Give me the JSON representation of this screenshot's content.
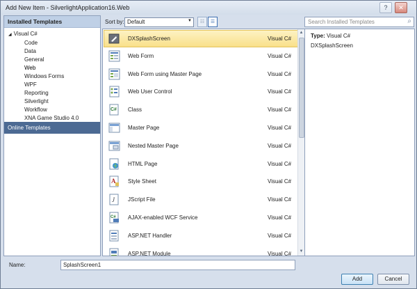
{
  "window": {
    "title": "Add New Item - SilverlightApplication16.Web",
    "help_glyph": "?",
    "close_glyph": "✕"
  },
  "left": {
    "header": "Installed Templates",
    "root": "Visual C#",
    "items": [
      "Code",
      "Data",
      "General",
      "Web",
      "Windows Forms",
      "WPF",
      "Reporting",
      "Silverlight",
      "Workflow",
      "XNA Game Studio 4.0"
    ],
    "selected_index": 3,
    "online": "Online Templates"
  },
  "sort": {
    "label": "Sort by:",
    "value": "Default"
  },
  "search": {
    "placeholder": "Search Installed Templates"
  },
  "templates": [
    {
      "name": "DXSplashScreen",
      "lang": "Visual C#",
      "icon": "splash-icon",
      "selected": true
    },
    {
      "name": "Web Form",
      "lang": "Visual C#",
      "icon": "web-form-icon"
    },
    {
      "name": "Web Form using Master Page",
      "lang": "Visual C#",
      "icon": "web-form-master-icon"
    },
    {
      "name": "Web User Control",
      "lang": "Visual C#",
      "icon": "user-control-icon"
    },
    {
      "name": "Class",
      "lang": "Visual C#",
      "icon": "class-icon"
    },
    {
      "name": "Master Page",
      "lang": "Visual C#",
      "icon": "master-page-icon"
    },
    {
      "name": "Nested Master Page",
      "lang": "Visual C#",
      "icon": "nested-master-icon"
    },
    {
      "name": "HTML Page",
      "lang": "Visual C#",
      "icon": "html-page-icon"
    },
    {
      "name": "Style Sheet",
      "lang": "Visual C#",
      "icon": "style-sheet-icon"
    },
    {
      "name": "JScript File",
      "lang": "Visual C#",
      "icon": "jscript-icon"
    },
    {
      "name": "AJAX-enabled WCF Service",
      "lang": "Visual C#",
      "icon": "wcf-service-icon"
    },
    {
      "name": "ASP.NET Handler",
      "lang": "Visual C#",
      "icon": "handler-icon"
    },
    {
      "name": "ASP.NET Module",
      "lang": "Visual C#",
      "icon": "module-icon"
    }
  ],
  "detail": {
    "type_label": "Type:",
    "type_value": "Visual C#",
    "description": "DXSplashScreen"
  },
  "name": {
    "label": "Name:",
    "value": "SplashScreen1"
  },
  "buttons": {
    "add": "Add",
    "cancel": "Cancel"
  }
}
